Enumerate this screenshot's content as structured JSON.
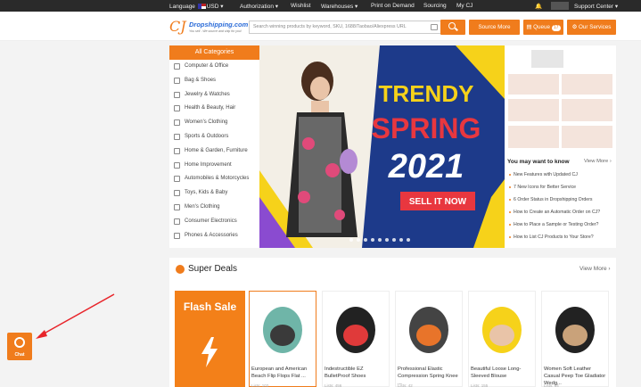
{
  "topbar": {
    "language": "Language",
    "currency": "USD",
    "authorization": "Authorization",
    "wishlist": "Wishlist",
    "warehouses": "Warehouses",
    "print_on_demand": "Print on Demand",
    "sourcing": "Sourcing",
    "my_cj": "My CJ",
    "support_center": "Support Center"
  },
  "header": {
    "logo_name": "Dropshipping.com",
    "logo_tagline": "You sell - We source and ship for you!",
    "search_placeholder": "Search winning products by keyword, SKU, 1688/Taobao/Aliexpress URL",
    "source_more": "Source More",
    "queue": "Queue",
    "queue_count": "17",
    "our_services": "Our Services"
  },
  "categories": {
    "header": "All Categories",
    "items": [
      "Computer & Office",
      "Bag & Shoes",
      "Jewelry & Watches",
      "Health & Beauty, Hair",
      "Women's Clothing",
      "Sports & Outdoors",
      "Home & Garden, Furniture",
      "Home Improvement",
      "Automobiles & Motorcycles",
      "Toys, Kids & Baby",
      "Men's Clothing",
      "Consumer Electronics",
      "Phones & Accessories"
    ]
  },
  "banner": {
    "line1": "TRENDY",
    "line2": "SPRING",
    "line3": "2021",
    "cta": "SELL IT NOW"
  },
  "news": {
    "title": "You may want to know",
    "view_more": "View More",
    "items": [
      "New Features with Updated CJ",
      "7 New Icons for Better Service",
      "6 Order Status in Dropshipping Orders",
      "How to Create an Automatic Order on CJ?",
      "How to Place a Sample or Testing Order?",
      "How to List CJ Products to Your Store?"
    ]
  },
  "deals": {
    "title": "Super Deals",
    "view_more": "View More",
    "flash_sale": "Flash Sale",
    "products": [
      {
        "name": "European and American Beach Flip Flops Flat ...",
        "lists": "Lists: 102"
      },
      {
        "name": "Indestructible EZ BulletProof Shoes",
        "lists": "Lists: 456"
      },
      {
        "name": "Professional Elastic Compression Spring Knee ...",
        "lists": "Lists: 42"
      },
      {
        "name": "Beautiful Loose Long-Sleeved Blouse",
        "lists": "Lists: 155"
      },
      {
        "name": "Women Soft Leather Casual Peep Toe Gladiator Wedg...",
        "lists": "Lists: 64"
      }
    ]
  },
  "chat": {
    "label": "Chat"
  },
  "colors": {
    "accent": "#f07c1c",
    "banner_bg": "#1d3a8a",
    "banner_title": "#f6d21a",
    "banner_spring": "#e8373f"
  }
}
